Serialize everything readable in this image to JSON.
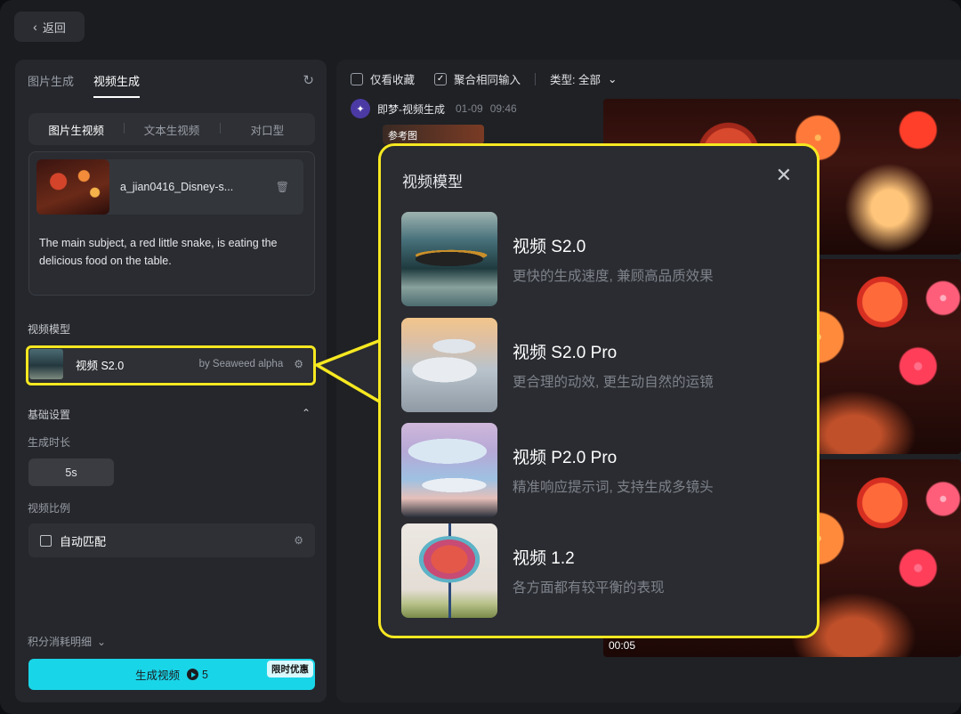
{
  "nav": {
    "back_label": "返回"
  },
  "left": {
    "tabs": [
      {
        "label": "图片生成",
        "active": false
      },
      {
        "label": "视频生成",
        "active": true
      }
    ],
    "sub_tabs": [
      {
        "label": "图片生视频",
        "active": true
      },
      {
        "label": "文本生视频",
        "active": false
      },
      {
        "label": "对口型",
        "active": false
      }
    ],
    "reference": {
      "file_name": "a_jian0416_Disney-s...",
      "prompt": "The main subject, a red little snake, is eating the delicious food on the table."
    },
    "model_section_label": "视频模型",
    "selected_model": {
      "name": "视频 S2.0",
      "by": "by Seaweed alpha"
    },
    "basic_settings_label": "基础设置",
    "duration_label": "生成时长",
    "duration_value": "5s",
    "ratio_label": "视频比例",
    "ratio_value": "自动匹配",
    "credits_label": "积分消耗明细",
    "generate_label": "生成视频",
    "generate_cost": "5",
    "promo_badge": "限时优惠"
  },
  "right": {
    "filters": {
      "favorites_only": "仅看收藏",
      "merge_same": "聚合相同输入",
      "type_label": "类型: 全部"
    },
    "generation": {
      "title": "即梦-视频生成",
      "date": "01-09",
      "time": "09:46",
      "ref_label": "参考图",
      "video_duration": "00:05"
    }
  },
  "popup": {
    "title": "视频模型",
    "models": [
      {
        "name": "视频 S2.0",
        "desc": "更快的生成速度, 兼顾高品质效果"
      },
      {
        "name": "视频 S2.0 Pro",
        "desc": "更合理的动效, 更生动自然的运镜"
      },
      {
        "name": "视频 P2.0 Pro",
        "desc": "精准响应提示词, 支持生成多镜头"
      },
      {
        "name": "视频 1.2",
        "desc": "各方面都有较平衡的表现"
      }
    ]
  },
  "colors": {
    "accent": "#19d5e8",
    "highlight": "#f6e821",
    "background": "#1b1c20"
  },
  "icons": {
    "back": "chevron-left-icon",
    "refresh": "refresh-icon",
    "trash": "trash-icon",
    "settings": "sliders-icon",
    "collapse": "chevron-up-icon",
    "close": "close-icon"
  }
}
